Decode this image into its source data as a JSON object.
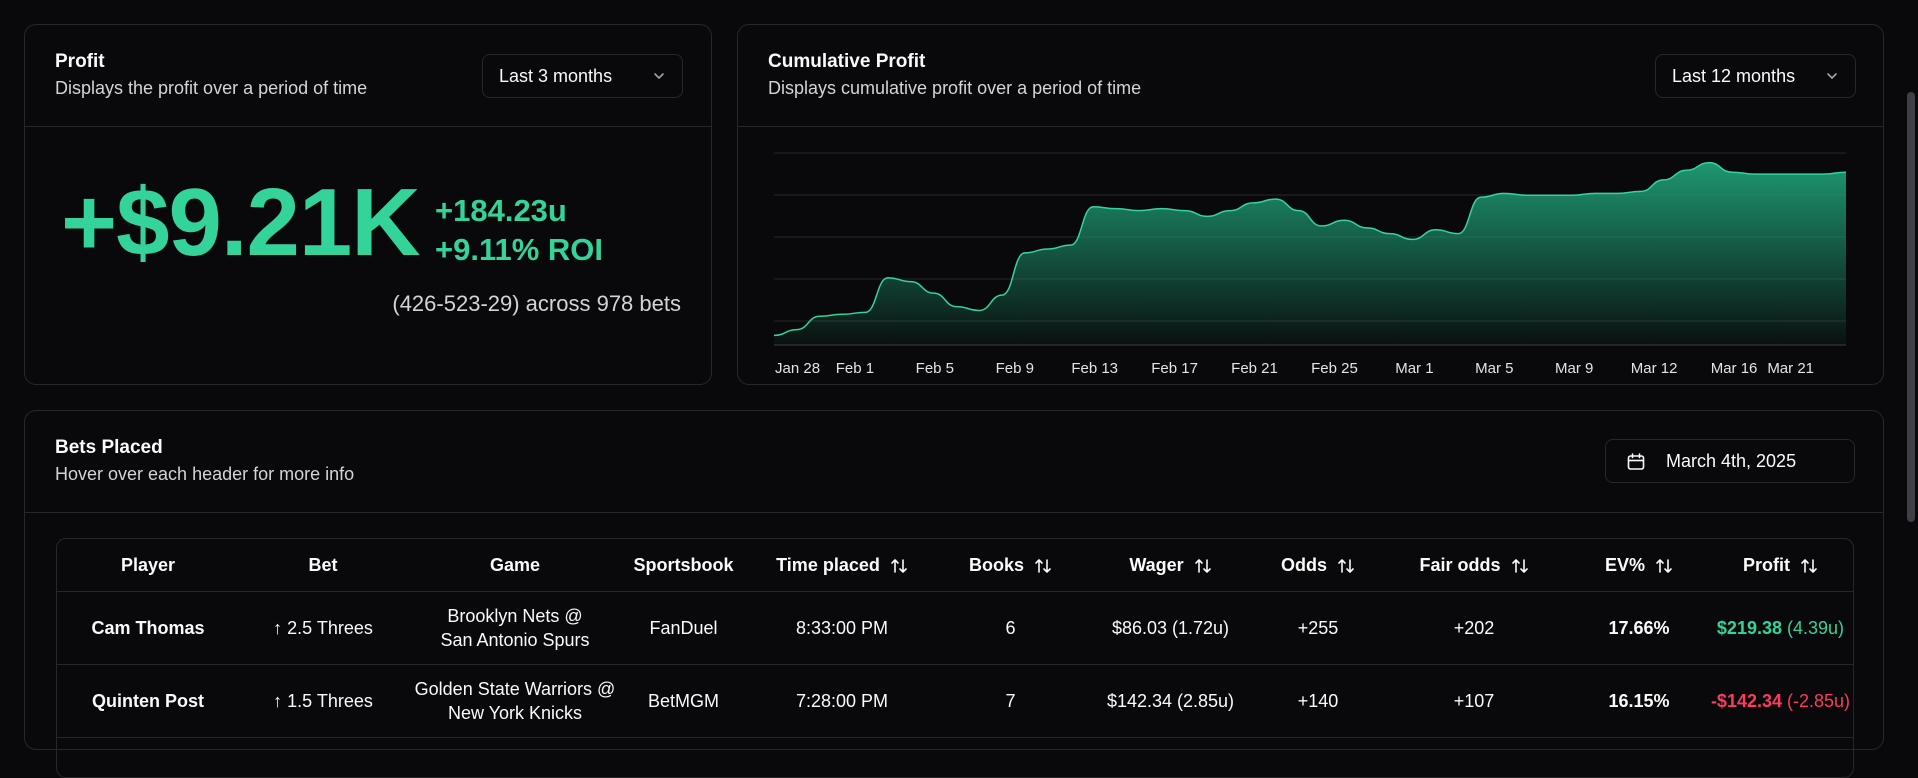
{
  "profit_card": {
    "title": "Profit",
    "subtitle": "Displays the profit over a period of time",
    "range_select": "Last 3 months",
    "profit": "+$9.21K",
    "units": "+184.23u",
    "roi": "+9.11% ROI",
    "record": "(426-523-29) across 978 bets"
  },
  "cum_card": {
    "title": "Cumulative Profit",
    "subtitle": "Displays cumulative profit over a period of time",
    "range_select": "Last 12 months"
  },
  "chart_data": {
    "type": "area",
    "x_labels": [
      "Jan 28",
      "Feb 1",
      "Feb 5",
      "Feb 9",
      "Feb 13",
      "Feb 17",
      "Feb 21",
      "Feb 25",
      "Mar 1",
      "Mar 5",
      "Mar 9",
      "Mar 12",
      "Mar 16",
      "Mar 21"
    ],
    "xlabel": "",
    "ylabel": "",
    "grid": true,
    "color": "#34d399",
    "values": [
      0.05,
      0.08,
      0.15,
      0.16,
      0.17,
      0.35,
      0.33,
      0.27,
      0.2,
      0.18,
      0.26,
      0.48,
      0.5,
      0.52,
      0.72,
      0.71,
      0.7,
      0.71,
      0.7,
      0.67,
      0.7,
      0.74,
      0.76,
      0.7,
      0.62,
      0.65,
      0.61,
      0.58,
      0.55,
      0.6,
      0.58,
      0.77,
      0.79,
      0.78,
      0.78,
      0.78,
      0.79,
      0.79,
      0.8,
      0.86,
      0.91,
      0.95,
      0.9,
      0.89,
      0.89,
      0.89,
      0.89,
      0.9
    ]
  },
  "bets_card": {
    "title": "Bets Placed",
    "subtitle": "Hover over each header for more info",
    "date": "March 4th, 2025"
  },
  "table": {
    "headers": [
      "Player",
      "Bet",
      "Game",
      "Sportsbook",
      "Time placed",
      "Books",
      "Wager",
      "Odds",
      "Fair odds",
      "EV%",
      "Profit"
    ],
    "rows": [
      {
        "player": "Cam Thomas",
        "bet": "↑ 2.5 Threes",
        "game1": "Brooklyn Nets @",
        "game2": "San Antonio Spurs",
        "book": "FanDuel",
        "time": "8:33:00 PM",
        "books": "6",
        "wager": "$86.03 (1.72u)",
        "odds": "+255",
        "fair": "+202",
        "ev": "17.66%",
        "profit": "$219.38",
        "profit_u": "(4.39u)"
      },
      {
        "player": "Quinten Post",
        "bet": "↑ 1.5 Threes",
        "game1": "Golden State Warriors @",
        "game2": "New York Knicks",
        "book": "BetMGM",
        "time": "7:28:00 PM",
        "books": "7",
        "wager": "$142.34 (2.85u)",
        "odds": "+140",
        "fair": "+107",
        "ev": "16.15%",
        "profit": "-$142.34",
        "profit_u": "(-2.85u)"
      }
    ]
  }
}
